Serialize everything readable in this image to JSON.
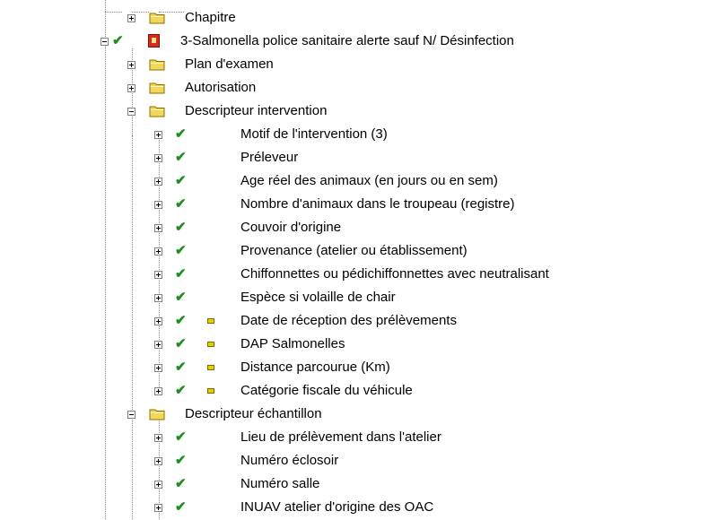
{
  "tree": {
    "top_folders": [
      {
        "label": "Chapitre",
        "icon": "folder-icon"
      }
    ],
    "root_item": {
      "label": "3-Salmonella police sanitaire alerte sauf N/ Désinfection",
      "icon": "document-icon"
    },
    "folders": [
      {
        "label": "Plan d'examen",
        "expanded": false
      },
      {
        "label": "Autorisation",
        "expanded": false
      },
      {
        "label": "Descripteur intervention",
        "expanded": true
      },
      {
        "label": "Descripteur échantillon",
        "expanded": true
      }
    ],
    "intervention_items": [
      {
        "label": "Motif de l'intervention (3)",
        "flag": false
      },
      {
        "label": "Préleveur",
        "flag": false
      },
      {
        "label": "Age réel des animaux (en jours ou en sem)",
        "flag": false
      },
      {
        "label": "Nombre d'animaux dans le troupeau (registre)",
        "flag": false
      },
      {
        "label": "Couvoir d'origine",
        "flag": false
      },
      {
        "label": "Provenance (atelier ou établissement)",
        "flag": false
      },
      {
        "label": "Chiffonnettes ou pédichiffonnettes avec neutralisant",
        "flag": false
      },
      {
        "label": "Espèce si volaille de chair",
        "flag": false
      },
      {
        "label": "Date de réception des prélèvements",
        "flag": true
      },
      {
        "label": "DAP Salmonelles",
        "flag": true
      },
      {
        "label": "Distance parcourue (Km)",
        "flag": true
      },
      {
        "label": "Catégorie fiscale du véhicule",
        "flag": true
      }
    ],
    "echantillon_items": [
      {
        "label": "Lieu de prélèvement dans l'atelier",
        "flag": false
      },
      {
        "label": "Numéro  éclosoir",
        "flag": false
      },
      {
        "label": "Numéro salle",
        "flag": false
      },
      {
        "label": "INUAV atelier d'origine des OAC",
        "flag": false
      }
    ],
    "colors": {
      "check": "#1f8c1f",
      "flag": "#e3cf00",
      "folder": "#f3d75a",
      "document": "#d62a1c"
    }
  }
}
